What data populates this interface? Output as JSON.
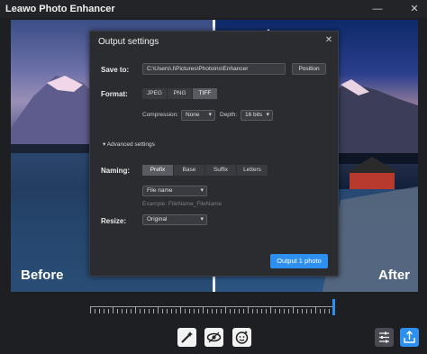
{
  "app": {
    "title": "Leawo Photo Enhancer"
  },
  "window": {
    "minimize_icon": "minimize-icon",
    "close_icon": "close-icon"
  },
  "preview": {
    "before_label": "Before",
    "after_label": "After"
  },
  "dialog": {
    "title": "Output settings",
    "save_to": {
      "label": "Save to:",
      "path": "C:\\Users\\.l\\Pictures\\Photoins\\Enhancer",
      "button": "Position"
    },
    "format": {
      "label": "Format:",
      "options": [
        "JPEG",
        "PNG",
        "TIFF"
      ],
      "selected": "TIFF"
    },
    "compression": {
      "label": "Compression:",
      "value": "None"
    },
    "depth": {
      "label": "Depth:",
      "value": "16 bits"
    },
    "advanced": {
      "label": "Advanced settings"
    },
    "naming": {
      "label": "Naming:",
      "tabs": [
        "Prefix",
        "Base",
        "Suffix",
        "Letters"
      ],
      "selected": "Prefix",
      "select_value": "File name",
      "example": "Example: FileName_FileName"
    },
    "resize": {
      "label": "Resize:",
      "value": "Original"
    },
    "output_button": "Output 1 photo"
  },
  "toolbar": {
    "tools": [
      {
        "name": "magic-wand-icon"
      },
      {
        "name": "eye-icon"
      },
      {
        "name": "face-enhance-icon"
      }
    ],
    "right": [
      {
        "name": "settings-sliders-icon",
        "bg": "#4a4b52"
      },
      {
        "name": "export-icon",
        "bg": "#2d8ff0"
      }
    ]
  },
  "colors": {
    "accent": "#2d8ff0",
    "dialog_bg": "#2b2c30",
    "app_bg": "#1e1f22"
  }
}
